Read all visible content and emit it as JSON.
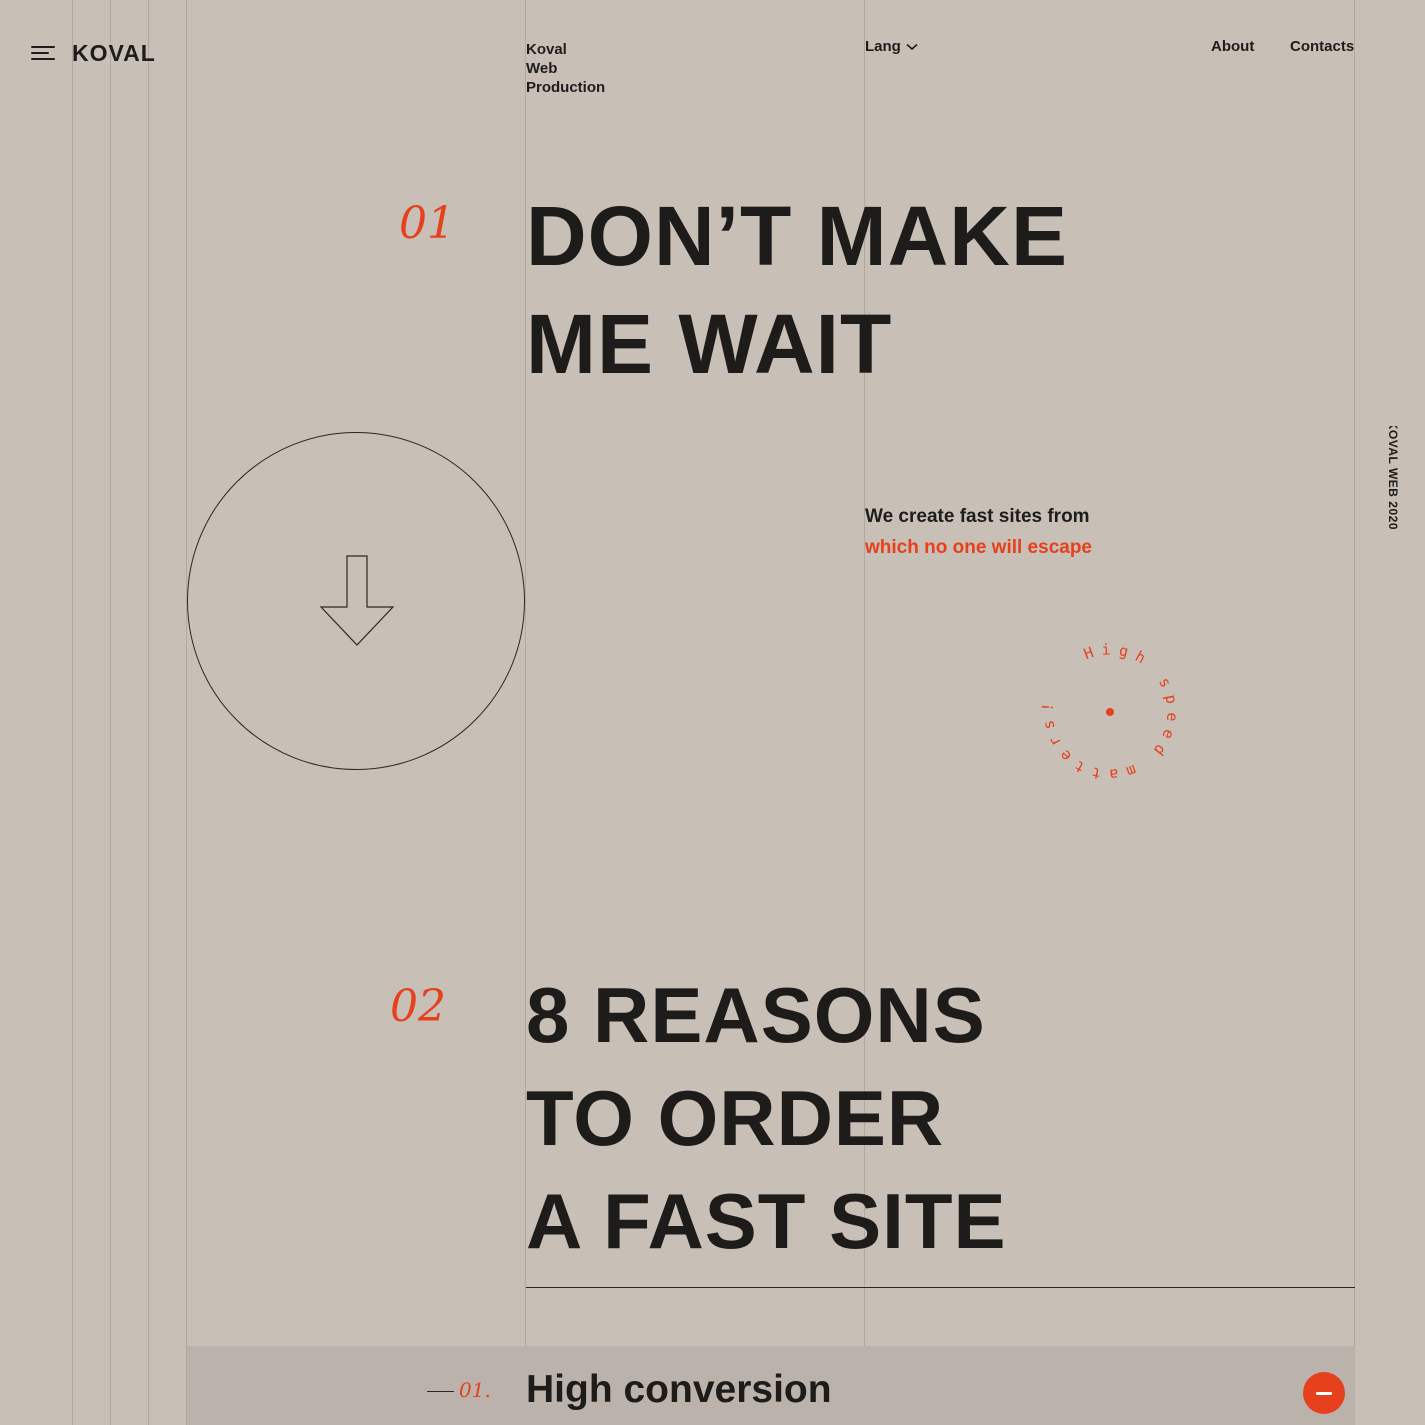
{
  "header": {
    "logo": "KOVAL",
    "tagline": [
      "Koval",
      "Web",
      "Production"
    ],
    "lang_label": "Lang",
    "nav": [
      {
        "label": "About"
      },
      {
        "label": "Contacts"
      }
    ]
  },
  "hero": {
    "number": "01",
    "title_lines": [
      "DON’T MAKE",
      "ME WAIT"
    ],
    "subtext_line1": "We create fast sites from",
    "subtext_line2": "which no one will escape",
    "circular_text": "High speed matters!"
  },
  "side_label": "2020 KOVAL WEB",
  "reasons": {
    "number": "02",
    "title_lines": [
      "8 REASONS",
      "TO ORDER",
      "A FAST SITE"
    ],
    "items": [
      {
        "number": "01.",
        "title": "High conversion",
        "expanded": true
      }
    ]
  },
  "colors": {
    "background": "#c8bfb7",
    "accent": "#e6411c",
    "text": "#1f1d1b"
  },
  "icons": {
    "menu": "hamburger-menu-icon",
    "lang": "chevron-down-icon",
    "scroll": "arrow-down-icon",
    "toggle": "minus-icon"
  }
}
